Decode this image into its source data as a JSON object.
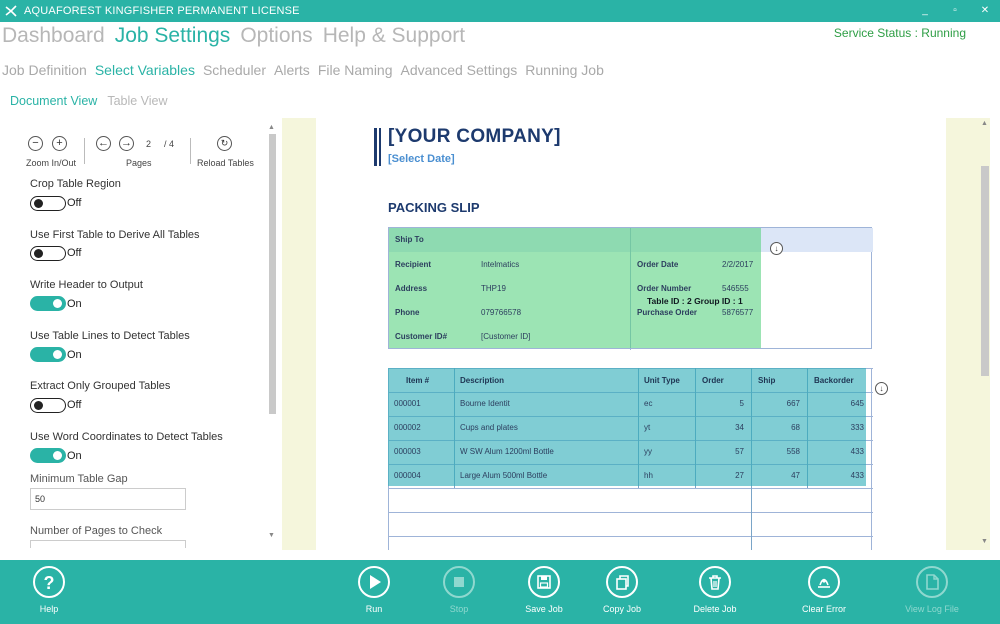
{
  "window": {
    "title": "AQUAFOREST KINGFISHER PERMANENT LICENSE",
    "minimize": "_",
    "maximize": "▫",
    "close": "✕"
  },
  "main_nav": [
    "Dashboard",
    "Job Settings",
    "Options",
    "Help & Support"
  ],
  "service_status": "Service Status : Running",
  "sub_nav": [
    "Job Definition",
    "Select Variables",
    "Scheduler",
    "Alerts",
    "File Naming",
    "Advanced Settings",
    "Running Job"
  ],
  "view_tabs": [
    "Document View",
    "Table View"
  ],
  "toolbar": {
    "zoom_label": "Zoom In/Out",
    "pages_label": "Pages",
    "current_page": "2",
    "total_pages": "/ 4",
    "reload_label": "Reload Tables"
  },
  "options": [
    {
      "label": "Crop Table Region",
      "state": "Off",
      "on": false
    },
    {
      "label": "Use First Table to Derive All Tables",
      "state": "Off",
      "on": false
    },
    {
      "label": "Write Header to Output",
      "state": "On",
      "on": true
    },
    {
      "label": "Use Table Lines to Detect Tables",
      "state": "On",
      "on": true
    },
    {
      "label": "Extract Only Grouped Tables",
      "state": "Off",
      "on": false
    },
    {
      "label": "Use Word Coordinates to Detect Tables",
      "state": "On",
      "on": true
    }
  ],
  "fields": {
    "min_gap_label": "Minimum Table Gap",
    "min_gap_value": "50",
    "pages_check_label": "Number of Pages to Check"
  },
  "document": {
    "company": "[YOUR COMPANY]",
    "select_date": "[Select Date]",
    "heading": "PACKING SLIP",
    "ship_to": "Ship To",
    "recipient_label": "Recipient",
    "recipient_value": "Intelmatics",
    "address_label": "Address",
    "address_value": "THP19",
    "phone_label": "Phone",
    "phone_value": "079766578",
    "customer_label": "Customer ID#",
    "customer_value": "[Customer ID]",
    "order_date_label": "Order Date",
    "order_date_value": "2/2/2017",
    "order_number_label": "Order Number",
    "order_number_value": "546555",
    "purchase_order_label": "Purchase Order",
    "purchase_order_value": "5876577",
    "table_id_overlay": "Table ID : 2  Group ID : 1",
    "items_headers": [
      "Item #",
      "Description",
      "Unit Type",
      "Order",
      "Ship",
      "Backorder"
    ],
    "items_rows": [
      [
        "000001",
        "Bourne Identit",
        "ec",
        "5",
        "667",
        "645"
      ],
      [
        "000002",
        "Cups and plates",
        "yt",
        "34",
        "68",
        "333"
      ],
      [
        "000003",
        "W SW Alum 1200ml Bottle",
        "yy",
        "57",
        "558",
        "433"
      ],
      [
        "000004",
        "Large  Alum 500ml Bottle",
        "hh",
        "27",
        "47",
        "433"
      ]
    ]
  },
  "bottom_bar": [
    {
      "label": "Help",
      "icon": "help-icon",
      "enabled": true
    },
    {
      "label": "Run",
      "icon": "play-icon",
      "enabled": true
    },
    {
      "label": "Stop",
      "icon": "stop-icon",
      "enabled": false
    },
    {
      "label": "Save Job",
      "icon": "save-icon",
      "enabled": true
    },
    {
      "label": "Copy Job",
      "icon": "copy-icon",
      "enabled": true
    },
    {
      "label": "Delete Job",
      "icon": "trash-icon",
      "enabled": true
    },
    {
      "label": "Clear Error",
      "icon": "clear-error-icon",
      "enabled": true
    },
    {
      "label": "View Log File",
      "icon": "log-file-icon",
      "enabled": false
    }
  ],
  "colors": {
    "accent": "#2ab3a6",
    "status_running": "#2e9e45",
    "doc_navy": "#1d3a6e"
  }
}
